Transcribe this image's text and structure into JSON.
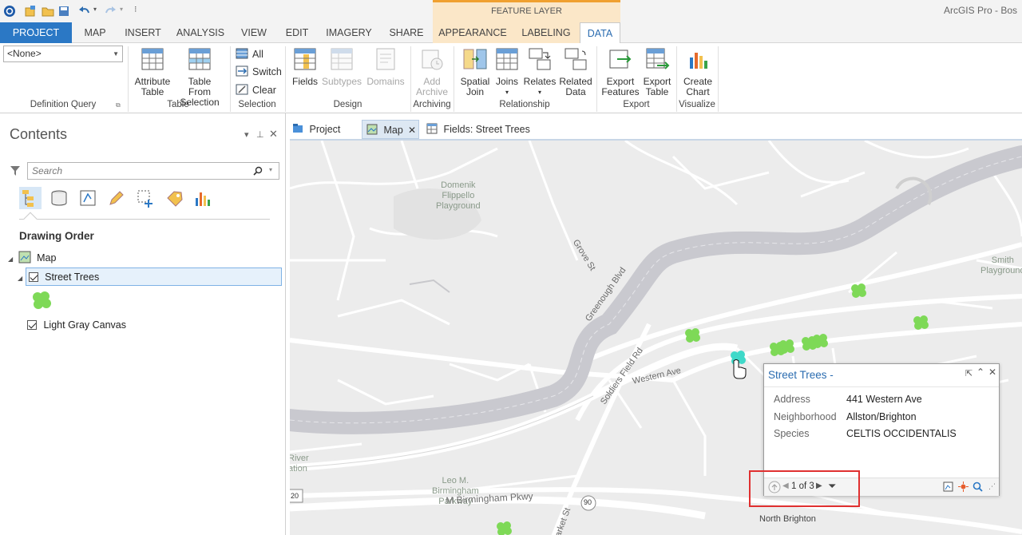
{
  "app": {
    "title": "ArcGIS Pro - Bos"
  },
  "context_band": {
    "label": "FEATURE LAYER"
  },
  "tabs": [
    {
      "label": "PROJECT"
    },
    {
      "label": "MAP"
    },
    {
      "label": "INSERT"
    },
    {
      "label": "ANALYSIS"
    },
    {
      "label": "VIEW"
    },
    {
      "label": "EDIT"
    },
    {
      "label": "IMAGERY"
    },
    {
      "label": "SHARE"
    },
    {
      "label": "APPEARANCE"
    },
    {
      "label": "LABELING"
    },
    {
      "label": "DATA"
    }
  ],
  "active_tab": "DATA",
  "ribbon": {
    "definition_query": {
      "select_value": "<None>",
      "group_label": "Definition Query"
    },
    "table": {
      "attribute_table": "Attribute\nTable",
      "table_from_selection": "Table From\nSelection",
      "group_label": "Table"
    },
    "selection": {
      "all": "All",
      "switch": "Switch",
      "clear": "Clear",
      "group_label": "Selection"
    },
    "design": {
      "fields": "Fields",
      "subtypes": "Subtypes",
      "domains": "Domains",
      "group_label": "Design"
    },
    "archiving": {
      "add_archive": "Add\nArchive",
      "group_label": "Archiving"
    },
    "relationship": {
      "spatial_join": "Spatial\nJoin",
      "joins": "Joins",
      "relates": "Relates",
      "related_data": "Related\nData",
      "group_label": "Relationship"
    },
    "export": {
      "export_features": "Export\nFeatures",
      "export_table": "Export\nTable",
      "group_label": "Export"
    },
    "visualize": {
      "create_chart": "Create\nChart",
      "group_label": "Visualize"
    }
  },
  "contents": {
    "title": "Contents",
    "search_placeholder": "Search",
    "section": "Drawing Order",
    "items": [
      {
        "label": "Map"
      },
      {
        "label": "Street Trees"
      },
      {
        "label": "Light Gray Canvas"
      }
    ]
  },
  "view_tabs": [
    {
      "label": "Project"
    },
    {
      "label": "Map"
    },
    {
      "label": "Fields:  Street Trees"
    }
  ],
  "map_labels": {
    "playground1": "Domenik\nFlippello\nPlayground",
    "grove": "Grove St",
    "greenough": "Greenough Blvd",
    "soldiers": "Soldiers Field Rd",
    "western": "Western Ave",
    "smith": "Smith\nPlayground",
    "river": "River\nation",
    "leo": "Leo M.\nBirmingham\nParkway",
    "birmingham": "M Birmingham Pkwy",
    "market": "arket St",
    "north_brighton": "North Brighton",
    "route": "90",
    "route2": "20"
  },
  "popup": {
    "title": "Street Trees -",
    "fields": [
      {
        "key": "Address",
        "value": "441 Western Ave"
      },
      {
        "key": "Neighborhood",
        "value": "Allston/Brighton"
      },
      {
        "key": "Species",
        "value": "CELTIS OCCIDENTALIS"
      }
    ],
    "pager": "1 of 3"
  },
  "colors": {
    "project_tab": "#2b78c5",
    "feature_layer_band": "#fbe7c8",
    "tree_symbol": "#7ed957",
    "selected_tree": "#3fd9c9",
    "highlight_box": "#e03030"
  }
}
